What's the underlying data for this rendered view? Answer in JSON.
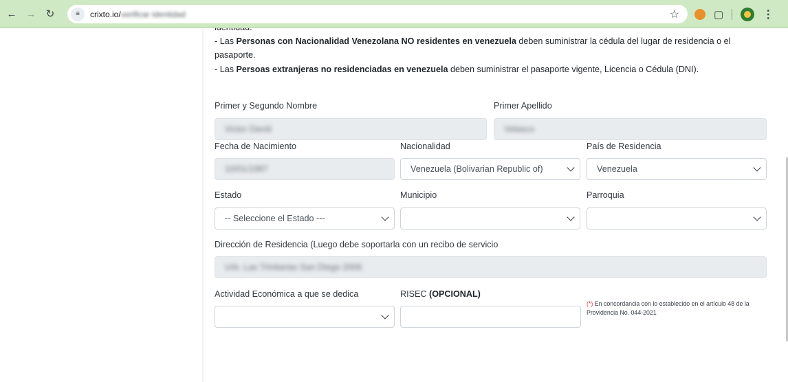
{
  "browser": {
    "url_host": "crixto.io/",
    "url_path": "verificar identidad",
    "site_info_icon": "tune-icon"
  },
  "intro": {
    "line0": "identidad.",
    "line1_prefix": "- Las ",
    "line1_bold": "Personas con Nacionalidad Venezolana NO residentes en venezuela",
    "line1_suffix": " deben suministrar la cédula del lugar de residencia o el",
    "line2": "pasaporte.",
    "line3_prefix": "- Las ",
    "line3_bold": "Persoas extranjeras no residenciadas en venezuela",
    "line3_suffix": " deben suministrar el pasaporte vigente, Licencia o Cédula (DNI)."
  },
  "form": {
    "first_names_label": "Primer y Segundo Nombre",
    "first_names_value": "Victor David",
    "surname_label": "Primer Apellido",
    "surname_value": "Velasco",
    "birthdate_label": "Fecha de Nacimiento",
    "birthdate_value": "10/01/1987",
    "nationality_label": "Nacionalidad",
    "nationality_value": "Venezuela (Bolivarian Republic of)",
    "residence_country_label": "País de Residencia",
    "residence_country_value": "Venezuela",
    "state_label": "Estado",
    "state_value": "-- Seleccione el Estado ---",
    "municipality_label": "Municipio",
    "municipality_value": "",
    "parish_label": "Parroquia",
    "parish_value": "",
    "address_label": "Dirección de Residencia (Luego debe soportarla con un recibo de servicio",
    "address_value": "Urb. Las Trinitarias San Diego 2006",
    "activity_label": "Actividad Económica a que se dedica",
    "activity_value": "",
    "risec_label": "RISEC ",
    "risec_label_bold": "(OPCIONAL)",
    "risec_value": "",
    "note_mark": "(*)",
    "note_text": " En concordancia con lo establecido en el artículo 48 de la Providencia No. 044-2021"
  }
}
